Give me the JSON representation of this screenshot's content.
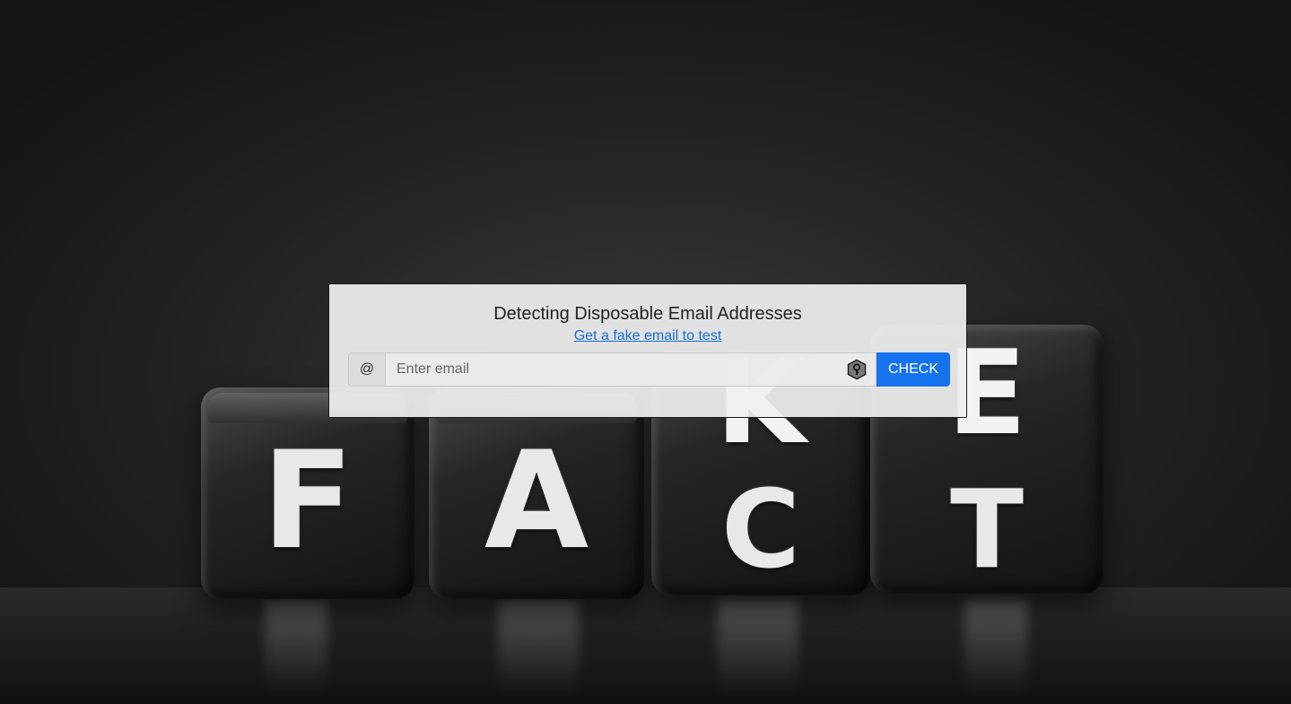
{
  "background": {
    "dice_letters": [
      "F",
      "A",
      "C",
      "T"
    ],
    "dice_top_letters": [
      "K",
      "E"
    ]
  },
  "card": {
    "title": "Detecting Disposable Email Addresses",
    "fake_email_link": "Get a fake email to test",
    "at_symbol": "@",
    "email_placeholder": "Enter email",
    "email_value": "",
    "check_label": "CHECK"
  },
  "colors": {
    "accent": "#1673ee",
    "link": "#1a6ed8"
  },
  "icons": {
    "password_manager": "key-hexagon-icon"
  }
}
